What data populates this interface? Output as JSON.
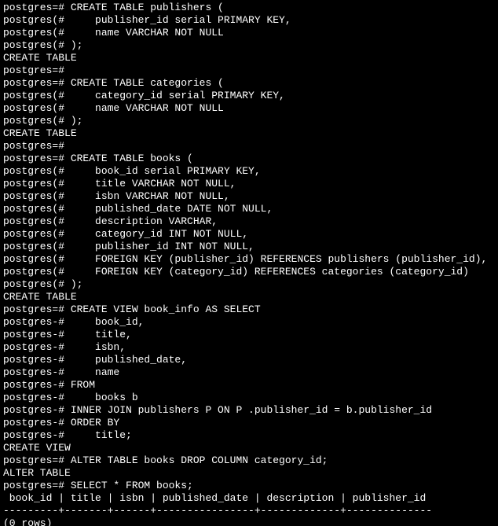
{
  "prompts": {
    "main": "postgres=#",
    "cont_paren": "postgres(#",
    "cont": "postgres-#"
  },
  "lines": [
    {
      "prompt": "main",
      "text": " CREATE TABLE publishers ("
    },
    {
      "prompt": "cont_paren",
      "text": "     publisher_id serial PRIMARY KEY,"
    },
    {
      "prompt": "cont_paren",
      "text": "     name VARCHAR NOT NULL"
    },
    {
      "prompt": "cont_paren",
      "text": " );"
    },
    {
      "prompt": null,
      "text": "CREATE TABLE"
    },
    {
      "prompt": "main",
      "text": ""
    },
    {
      "prompt": "main",
      "text": " CREATE TABLE categories ("
    },
    {
      "prompt": "cont_paren",
      "text": "     category_id serial PRIMARY KEY,"
    },
    {
      "prompt": "cont_paren",
      "text": "     name VARCHAR NOT NULL"
    },
    {
      "prompt": "cont_paren",
      "text": " );"
    },
    {
      "prompt": null,
      "text": "CREATE TABLE"
    },
    {
      "prompt": "main",
      "text": ""
    },
    {
      "prompt": "main",
      "text": " CREATE TABLE books ("
    },
    {
      "prompt": "cont_paren",
      "text": "     book_id serial PRIMARY KEY,"
    },
    {
      "prompt": "cont_paren",
      "text": "     title VARCHAR NOT NULL,"
    },
    {
      "prompt": "cont_paren",
      "text": "     isbn VARCHAR NOT NULL,"
    },
    {
      "prompt": "cont_paren",
      "text": "     published_date DATE NOT NULL,"
    },
    {
      "prompt": "cont_paren",
      "text": "     description VARCHAR,"
    },
    {
      "prompt": "cont_paren",
      "text": "     category_id INT NOT NULL,"
    },
    {
      "prompt": "cont_paren",
      "text": "     publisher_id INT NOT NULL,"
    },
    {
      "prompt": "cont_paren",
      "text": "     FOREIGN KEY (publisher_id) REFERENCES publishers (publisher_id),"
    },
    {
      "prompt": "cont_paren",
      "text": "     FOREIGN KEY (category_id) REFERENCES categories (category_id)"
    },
    {
      "prompt": "cont_paren",
      "text": " );"
    },
    {
      "prompt": null,
      "text": "CREATE TABLE"
    },
    {
      "prompt": "main",
      "text": " CREATE VIEW book_info AS SELECT"
    },
    {
      "prompt": "cont",
      "text": "     book_id,"
    },
    {
      "prompt": "cont",
      "text": "     title,"
    },
    {
      "prompt": "cont",
      "text": "     isbn,"
    },
    {
      "prompt": "cont",
      "text": "     published_date,"
    },
    {
      "prompt": "cont",
      "text": "     name"
    },
    {
      "prompt": "cont",
      "text": " FROM"
    },
    {
      "prompt": "cont",
      "text": "     books b"
    },
    {
      "prompt": "cont",
      "text": " INNER JOIN publishers P ON P .publisher_id = b.publisher_id"
    },
    {
      "prompt": "cont",
      "text": " ORDER BY"
    },
    {
      "prompt": "cont",
      "text": "     title;"
    },
    {
      "prompt": null,
      "text": "CREATE VIEW"
    },
    {
      "prompt": "main",
      "text": " ALTER TABLE books DROP COLUMN category_id;"
    },
    {
      "prompt": null,
      "text": "ALTER TABLE"
    },
    {
      "prompt": "main",
      "text": " SELECT * FROM books;"
    },
    {
      "prompt": null,
      "text": " book_id | title | isbn | published_date | description | publisher_id"
    },
    {
      "prompt": null,
      "text": "---------+-------+------+----------------+-------------+--------------"
    },
    {
      "prompt": null,
      "text": "(0 rows)"
    }
  ]
}
